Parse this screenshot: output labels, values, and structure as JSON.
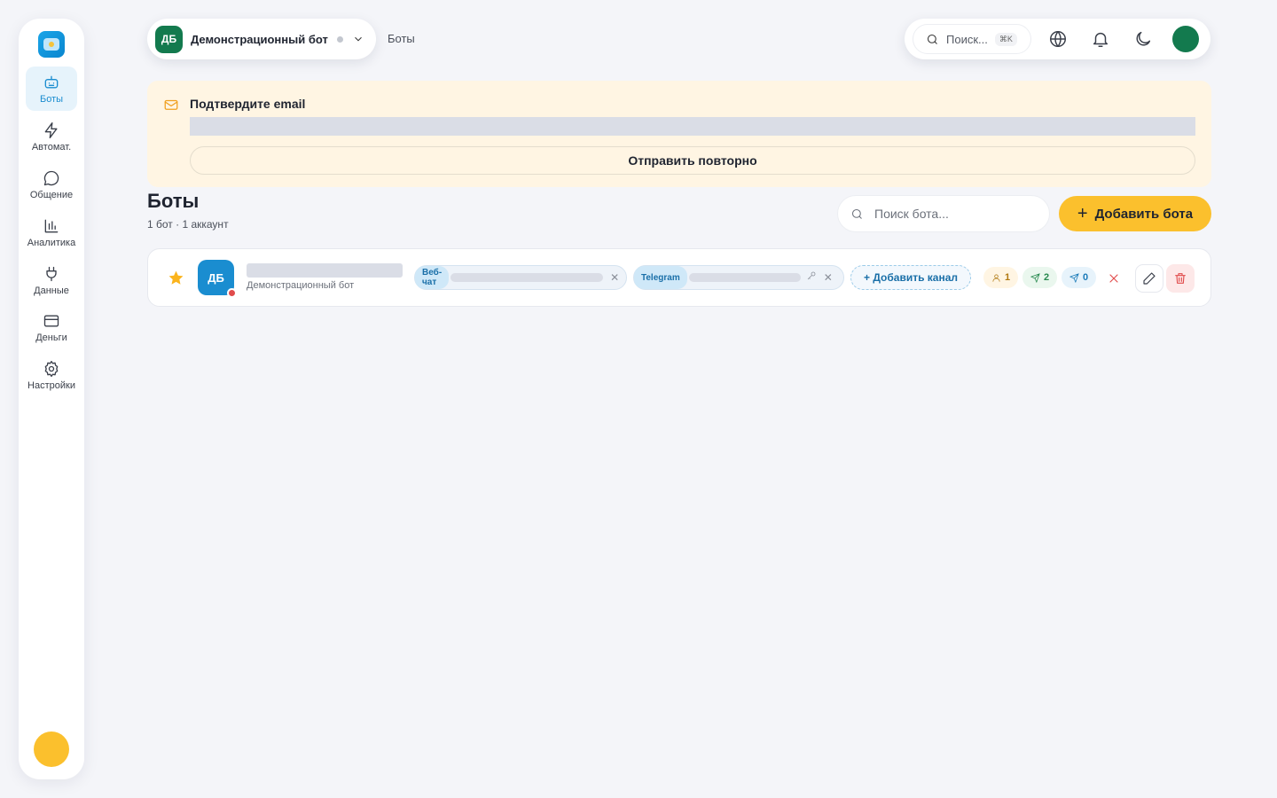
{
  "sidebar": {
    "items": [
      {
        "label": "Боты",
        "icon": "bot-icon",
        "active": true
      },
      {
        "label": "Автомат.",
        "icon": "lightning-icon"
      },
      {
        "label": "Общение",
        "icon": "chat-icon"
      },
      {
        "label": "Аналитика",
        "icon": "chart-icon"
      },
      {
        "label": "Данные",
        "icon": "plug-icon"
      },
      {
        "label": "Деньги",
        "icon": "card-icon"
      },
      {
        "label": "Настройки",
        "icon": "gear-icon"
      }
    ]
  },
  "header": {
    "bot_initials": "ДБ",
    "bot_name": "Демонстрационный бот",
    "breadcrumb": "Боты",
    "search_placeholder": "Поиск...",
    "search_shortcut": "⌘K"
  },
  "banner": {
    "title": "Подтвердите email",
    "resend_label": "Отправить повторно"
  },
  "page": {
    "title": "Боты",
    "subtitle": "1 бот · 1 аккаунт",
    "search_placeholder": "Поиск бота...",
    "add_label": "Добавить бота"
  },
  "bot": {
    "initials": "ДБ",
    "description": "Демонстрационный бот",
    "channels": [
      {
        "label": "Веб-\nчат"
      },
      {
        "label": "Telegram"
      }
    ],
    "add_channel_label": "+ Добавить канал",
    "stats": {
      "users": "1",
      "sent": "2",
      "received": "0"
    }
  },
  "colors": {
    "accent": "#fbc02d",
    "primary": "#1a8dd0",
    "green": "#137a4e",
    "danger": "#e04b4b"
  }
}
